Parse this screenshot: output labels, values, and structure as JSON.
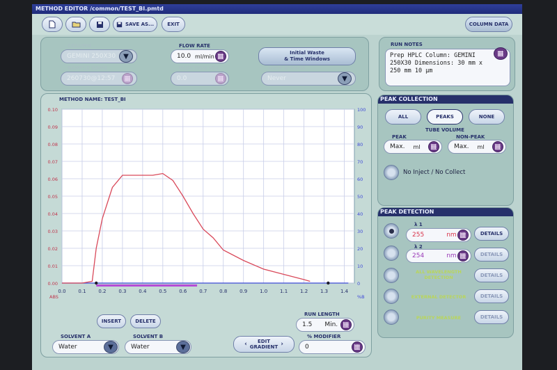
{
  "window": {
    "title": "METHOD EDITOR /common/TEST_BI.pmtd"
  },
  "toolbar": {
    "save_as": "SAVE AS...",
    "exit": "EXIT",
    "column_data": "COLUMN DATA"
  },
  "top": {
    "column_label": "COLUMN",
    "column_value": "GEMINI 250X30",
    "sample_label": "SAMPLE NAME",
    "sample_value": "260730@12:57",
    "flow_label": "FLOW RATE",
    "flow_value": "10.0",
    "flow_unit": "ml/min",
    "inj_label": "INJECTION VOL",
    "inj_value": "0.0",
    "inj_unit": "ml",
    "initial_waste": "Initial Waste\n& Time Windows",
    "loop_label": "LOOP BYPASS",
    "loop_value": "Never",
    "notes_label": "RUN NOTES",
    "notes_text": "Prep HPLC Column: GEMINI 250X30 Dimensions: 30 mm x 250 mm 10 µm"
  },
  "graph": {
    "method_name": "METHOD NAME: TEST_BI",
    "left_axis": [
      "0.10",
      "0.09",
      "0.08",
      "0.07",
      "0.06",
      "0.05",
      "0.04",
      "0.03",
      "0.02",
      "0.01",
      "0.00"
    ],
    "right_axis": [
      "100",
      "90",
      "80",
      "70",
      "60",
      "50",
      "40",
      "30",
      "20",
      "10",
      "0"
    ],
    "x_axis": [
      "0.0",
      "0.1",
      "0.2",
      "0.3",
      "0.4",
      "0.5",
      "0.6",
      "0.7",
      "0.8",
      "0.9",
      "1.0",
      "1.1",
      "1.2",
      "1.3",
      "1.4"
    ],
    "abs_label": "ABS",
    "pct_label": "%B"
  },
  "chart_data": {
    "type": "line",
    "x": [
      0.0,
      0.1,
      0.15,
      0.17,
      0.2,
      0.25,
      0.3,
      0.35,
      0.4,
      0.45,
      0.5,
      0.55,
      0.6,
      0.65,
      0.7,
      0.75,
      0.8,
      0.9,
      1.0,
      1.1,
      1.2,
      1.23
    ],
    "absorbance": [
      0.0,
      0.0,
      0.001,
      0.02,
      0.037,
      0.055,
      0.062,
      0.062,
      0.062,
      0.062,
      0.063,
      0.059,
      0.05,
      0.04,
      0.031,
      0.026,
      0.019,
      0.013,
      0.008,
      0.005,
      0.002,
      0.001
    ],
    "percent_b_line": {
      "x": [
        0.0,
        1.42
      ],
      "y": [
        0,
        0
      ]
    },
    "collection_window": [
      0.17,
      0.67
    ],
    "markers_x": [
      0.17,
      1.32
    ],
    "xlim": [
      0.0,
      1.45
    ],
    "ylim_left": [
      0.0,
      0.1
    ],
    "ylim_right": [
      0,
      100
    ],
    "colors": {
      "absorbance": "#d9495a",
      "percent_b": "#3f4ad8",
      "collection": "#b64bd6"
    }
  },
  "bottom": {
    "insert": "INSERT",
    "delete": "DELETE",
    "run_length_label": "RUN LENGTH",
    "run_length_value": "1.5",
    "run_length_unit": "Min.",
    "solvent_a_label": "SOLVENT A",
    "solvent_a_value": "Water",
    "solvent_b_label": "SOLVENT B",
    "solvent_b_value": "Water",
    "edit_gradient": "EDIT\nGRADIENT",
    "modifier_label": "% MODIFIER",
    "modifier_value": "0"
  },
  "peak_collection": {
    "title": "PEAK COLLECTION",
    "all": "ALL",
    "peaks": "PEAKS",
    "none": "NONE",
    "tube_volume": "TUBE VOLUME",
    "peak_label": "PEAK",
    "peak_value": "Max.",
    "peak_unit": "ml",
    "nonpeak_label": "NON-PEAK",
    "nonpeak_value": "Max.",
    "nonpeak_unit": "ml",
    "no_inject": "No Inject / No Collect"
  },
  "peak_detection": {
    "title": "PEAK DETECTION",
    "l1_label": "λ 1",
    "l1_value": "255",
    "l1_unit": "nm",
    "l2_label": "λ 2",
    "l2_value": "254",
    "l2_unit": "nm",
    "all_wavelength": "ALL WAVELENGTH\nDETECTION",
    "external": "EXTERNAL DETECTOR",
    "purity": "PURITY MEASURE",
    "details": "DETAILS",
    "colors": {
      "lambda_value": "#d8334a"
    }
  }
}
